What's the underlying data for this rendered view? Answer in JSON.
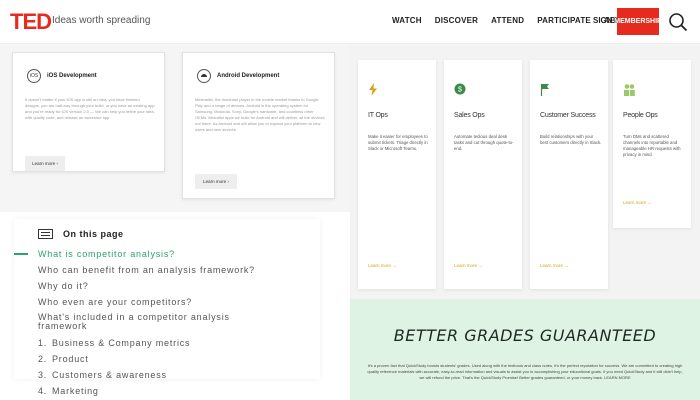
{
  "header": {
    "logo": "TED",
    "tagline": "Ideas worth spreading",
    "nav": [
      "WATCH",
      "DISCOVER",
      "ATTEND",
      "PARTICIPATE",
      "ABOUT"
    ],
    "sign_in": "SIGN IN",
    "membership": "MEMBERSHIP",
    "brand_color": "#e62b1e"
  },
  "dev_cards": [
    {
      "icon": "ios-icon",
      "title": "iOS Development",
      "body": "It doesn't matter if your iOS app is still an idea, you have finished designs, you are half-way through your build, or you have an existing app and you're ready for iOS version 2.0 — We can help you refine your idea, with quality code, and release an awesome app.",
      "button": "Learn more ›"
    },
    {
      "icon": "android-icon",
      "title": "Android Development",
      "body": "Minimalist, the dominant player in the mobile market thanks to Google Play and a range of devices. Android is the operating system for Samsung, Motorola, Sony, Google's hardware, and countless other OEMs. Beautiful apps we build for Android and will deliver, all the devices out there. As Android and will allow you to expand your platform to new users and new devices.",
      "button": "Learn more ›"
    }
  ],
  "on_this_page": {
    "title": "On this page",
    "items": [
      {
        "label": "What is competitor analysis?",
        "num": ""
      },
      {
        "label": "Who can benefit from an analysis framework?",
        "num": ""
      },
      {
        "label": "Why do it?",
        "num": ""
      },
      {
        "label": "Who even are your competitors?",
        "num": ""
      },
      {
        "label": "What's included in a competitor analysis framework",
        "num": ""
      },
      {
        "label": "Business & Company metrics",
        "num": "1."
      },
      {
        "label": "Product",
        "num": "2."
      },
      {
        "label": "Customers & awareness",
        "num": "3."
      },
      {
        "label": "Marketing",
        "num": "4."
      }
    ],
    "accent": "#2ea36a"
  },
  "ops_cards": [
    {
      "title": "IT Ops",
      "body": "Make it easier for employees to submit tickets. Triage directly in Slack or Microsoft Teams.",
      "link": "Learn more →",
      "icon": "lightning-icon"
    },
    {
      "title": "Sales Ops",
      "body": "Automate tedious deal desk tasks and cut through quote-to-end.",
      "link": "Learn more →",
      "icon": "dollar-icon"
    },
    {
      "title": "Customer Success",
      "body": "Build relationships with your best customers directly in Slack.",
      "link": "Learn more →",
      "icon": "flag-icon"
    },
    {
      "title": "People Ops",
      "body": "Turn DMs and scattered channels into reportable and manageable HR requests with privacy in mind.",
      "link": "Learn more →",
      "icon": "people-icon"
    }
  ],
  "grades": {
    "title": "BETTER GRADES GUARANTEED",
    "body": "It's a proven fact that QuickStudy boosts students' grades. Used along with the textbook and class notes, it's the perfect reputation for success. We are committed to creating high quality reference materials with accurate, easy-to-read information and visuals to assist you in accomplishing your educational goals. If you need QuickStudy and it still didn't help, we will refund the price. That's the QuickStudy Promise! Better grades guaranteed, or your money back. LEARN MORE",
    "bg_color": "#dff3e4"
  }
}
